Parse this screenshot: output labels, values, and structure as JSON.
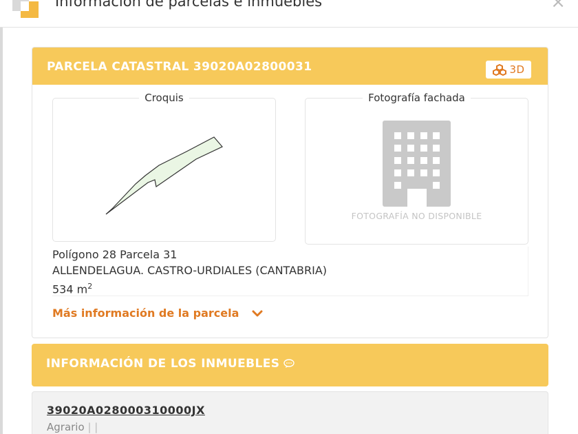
{
  "header": {
    "title": "Información de parcelas e inmuebles",
    "close_label": "×",
    "app_icon": "layers-icon"
  },
  "parcel": {
    "title": "PARCELA CATASTRAL 39020A02800031",
    "btn_3d_label": "3D",
    "croquis_label": "Croquis",
    "foto_label": "Fotografía fachada",
    "no_photo_text": "FOTOGRAFÍA NO DISPONIBLE",
    "poligono_line": "Polígono 28 Parcela 31",
    "location_line": "ALLENDELAGUA. CASTRO-URDIALES (CANTABRIA)",
    "area_value": "534 m",
    "area_unit_sup": "2",
    "more_info_label": "Más información de la parcela"
  },
  "inmuebles": {
    "title": "INFORMACIÓN DE LOS INMUEBLES",
    "items": [
      {
        "ref": "39020A028000310000JX",
        "uso": "Agrario",
        "sep1": "|",
        "sep2": "|"
      }
    ]
  },
  "colors": {
    "header_bg": "#f7c95a",
    "accent": "#e07a22",
    "sketch_fill": "#eaf6e4"
  }
}
